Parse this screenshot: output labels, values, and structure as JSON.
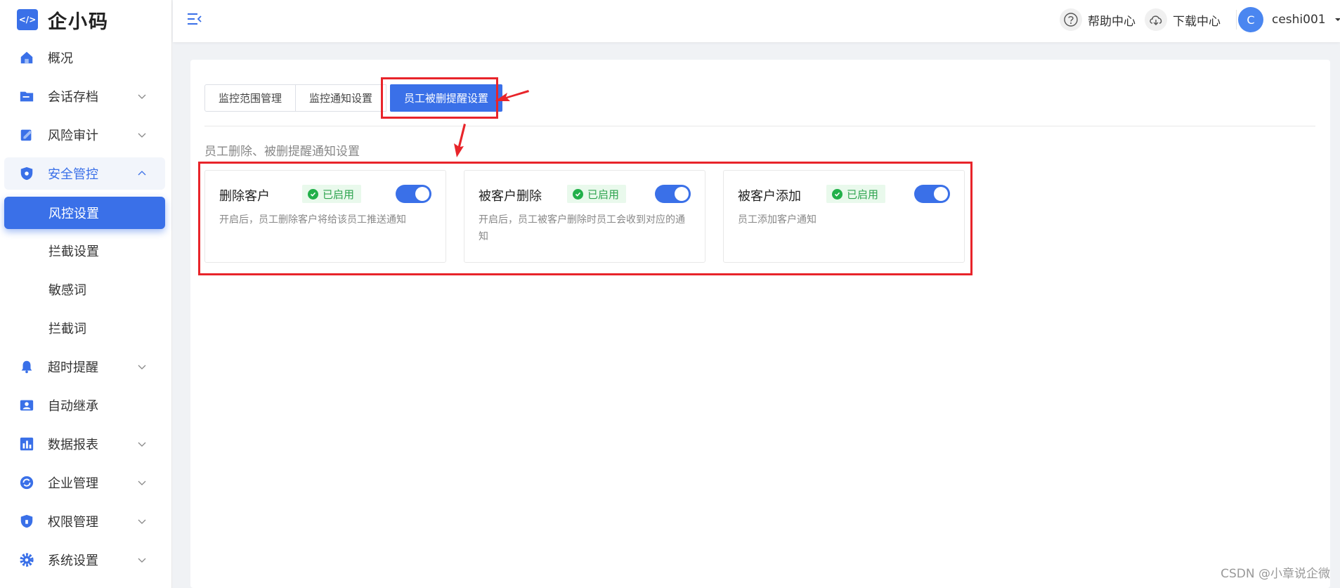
{
  "app": {
    "logo_text": "企小码",
    "logo_glyph": "</>"
  },
  "sidebar": {
    "items": [
      {
        "label": "概况",
        "icon": "home-icon"
      },
      {
        "label": "会话存档",
        "icon": "folder-icon"
      },
      {
        "label": "风险审计",
        "icon": "audit-icon"
      },
      {
        "label": "安全管控",
        "icon": "shield-icon"
      },
      {
        "label": "超时提醒",
        "icon": "bell-icon"
      },
      {
        "label": "自动继承",
        "icon": "user-card-icon"
      },
      {
        "label": "数据报表",
        "icon": "bar-chart-icon"
      },
      {
        "label": "企业管理",
        "icon": "sync-icon"
      },
      {
        "label": "权限管理",
        "icon": "lock-shield-icon"
      },
      {
        "label": "系统设置",
        "icon": "gear-icon"
      }
    ],
    "sub_items": [
      "风控设置",
      "拦截设置",
      "敏感词",
      "拦截词"
    ]
  },
  "header": {
    "help": "帮助中心",
    "download": "下载中心",
    "avatar_letter": "C",
    "username": "ceshi001"
  },
  "tabs": [
    "监控范围管理",
    "监控通知设置",
    "员工被删提醒设置"
  ],
  "section_title": "员工删除、被删提醒通知设置",
  "cards": [
    {
      "title": "删除客户",
      "status": "已启用",
      "desc": "开启后，员工删除客户将给该员工推送通知"
    },
    {
      "title": "被客户删除",
      "status": "已启用",
      "desc": "开启后，员工被客户删除时员工会收到对应的通知"
    },
    {
      "title": "被客户添加",
      "status": "已启用",
      "desc": "员工添加客户通知"
    }
  ],
  "watermark": "CSDN @小章说企微",
  "colors": {
    "accent": "#3a70e8",
    "success": "#22b04a",
    "annotation": "#e8242a"
  }
}
